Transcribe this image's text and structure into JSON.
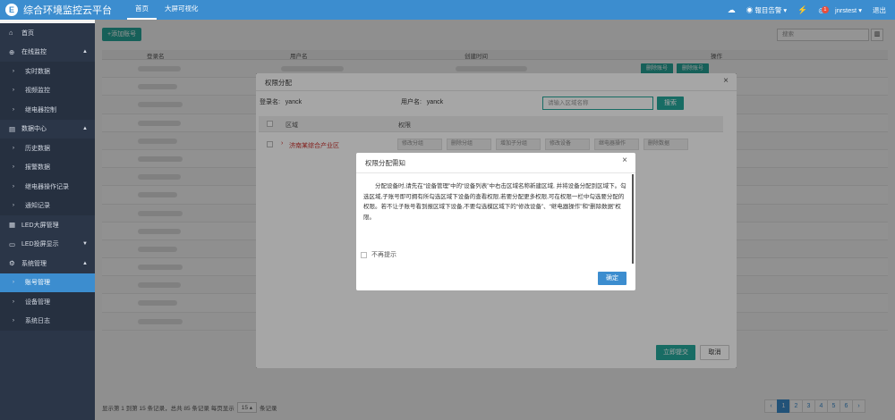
{
  "app": {
    "title": "综合环境监控云平台",
    "logo_letter": "E"
  },
  "topnav": [
    {
      "label": "首页"
    },
    {
      "label": "大屏可视化"
    }
  ],
  "topright": {
    "alarm_label": "報目告警",
    "badge_count": "1",
    "user": "jnrstest",
    "logout": "退出"
  },
  "sidebar": {
    "items": [
      {
        "label": "首页",
        "icon": "home-icon"
      },
      {
        "label": "在线监控",
        "icon": "globe-icon",
        "caret": "▲"
      },
      {
        "label": "实时数据"
      },
      {
        "label": "视频监控"
      },
      {
        "label": "继电器控制"
      },
      {
        "label": "数据中心",
        "icon": "list-icon",
        "caret": "▲"
      },
      {
        "label": "历史数据"
      },
      {
        "label": "报警数据"
      },
      {
        "label": "继电器操作记录"
      },
      {
        "label": "通知记录"
      },
      {
        "label": "LED大屏管理",
        "icon": "grid-icon"
      },
      {
        "label": "LED投屏显示",
        "icon": "monitor-icon",
        "caret": "▼"
      },
      {
        "label": "系统管理",
        "icon": "gear-icon",
        "caret": "▲"
      },
      {
        "label": "账号管理"
      },
      {
        "label": "设备管理"
      },
      {
        "label": "系统日志"
      }
    ]
  },
  "main": {
    "add_button": "+添加账号",
    "search_placeholder": "搜索",
    "columns": {
      "login": "登录名",
      "user": "用户名",
      "created": "创建时间",
      "ops": "操作"
    },
    "row_buttons": [
      "删除账号",
      "删除账号"
    ],
    "footer": {
      "info": "显示第 1 到第 15 条记录，总共 85 条记录 每页显示",
      "page_size": "15",
      "suffix": "条记录"
    },
    "pager": [
      "‹",
      "1",
      "2",
      "3",
      "4",
      "5",
      "6",
      "›"
    ]
  },
  "perm_modal": {
    "title": "权限分配",
    "login_label": "登录名:",
    "login_value": "yanck",
    "user_label": "用户名:",
    "user_value": "yanck",
    "search_placeholder": "请输入区域名称",
    "search_button": "搜索",
    "col_area": "区域",
    "col_perm": "权限",
    "area_name": "济南某综合产业区",
    "perms": [
      "修改分组",
      "删除分组",
      "增加子分组",
      "修改设备",
      "继电器操作",
      "删除数据"
    ],
    "submit": "立即提交",
    "cancel": "取消"
  },
  "notice": {
    "title": "权限分配需知",
    "body": "分配设备时,请先在“设备管理”中的“设备列表”中右击区域名称新建区域, 并将设备分配到区域下。勾选区域,子账号即可拥有所勾选区域下设备的查看权限,若要分配更多权限,可在权限一栏中勾选要分配的权限。若不让子账号看到报区域下设备,不要勾选模区域下的“修改设备”、“继电器操作”和“删除数据”权限。",
    "dont_show": "不再提示",
    "ok": "确定"
  }
}
